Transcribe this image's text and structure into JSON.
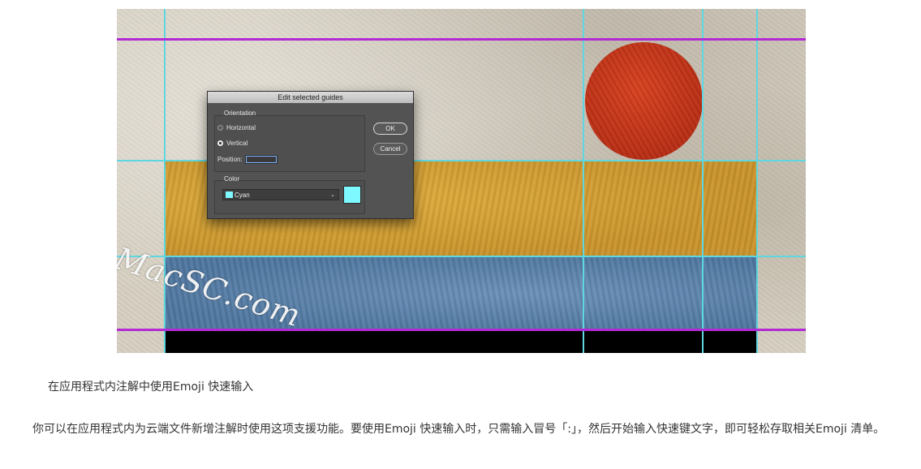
{
  "figure": {
    "watermark": "MacSC.com",
    "dialog": {
      "title": "Edit selected guides",
      "orientation_label": "Orientation",
      "options": [
        {
          "label": "Horizontal",
          "selected": false
        },
        {
          "label": "Vertical",
          "selected": true
        }
      ],
      "position_label": "Position:",
      "position_value": "",
      "color_label": "Color",
      "color_value": "Cyan",
      "color_hex": "#7df9ff",
      "ok_label": "OK",
      "cancel_label": "Cancel"
    }
  },
  "article": {
    "caption": "在应用程式内注解中使用Emoji 快速输入",
    "paragraph": "你可以在应用程式内为云端文件新增注解时使用这项支援功能。要使用Emoji 快速输入时，只需输入冒号「:」，然后开始输入快速键文字，即可轻松存取相关Emoji 清单。"
  }
}
